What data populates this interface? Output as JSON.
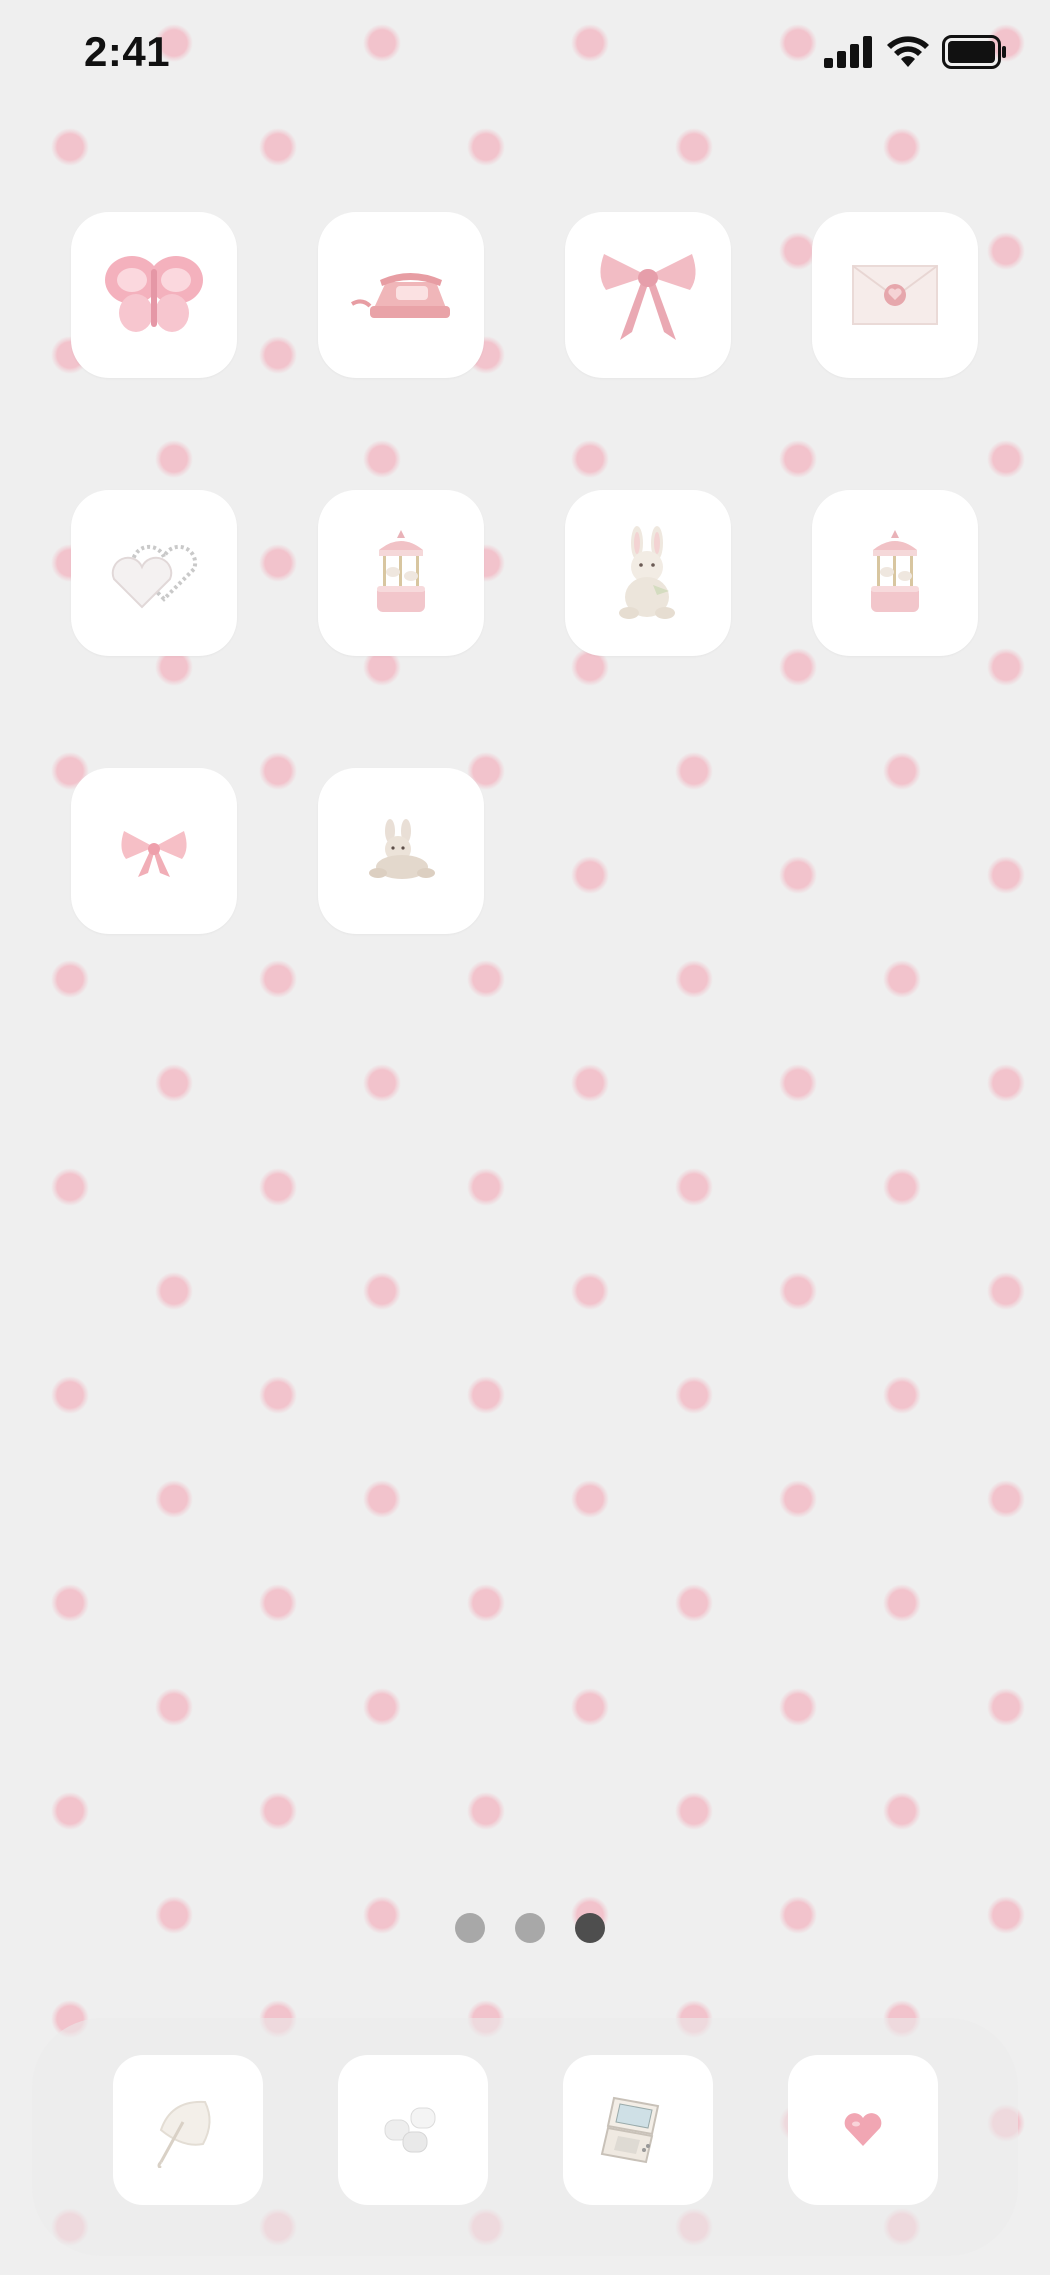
{
  "status_bar": {
    "time": "2:41",
    "icons": [
      "cellular-signal-icon",
      "wifi-icon",
      "battery-icon"
    ]
  },
  "home_grid": {
    "apps": [
      {
        "icon": "pink-butterfly-icon"
      },
      {
        "icon": "pink-telephone-icon"
      },
      {
        "icon": "pink-ribbon-bow-icon"
      },
      {
        "icon": "sealed-envelope-icon"
      },
      {
        "icon": "pearl-hearts-icon"
      },
      {
        "icon": "carousel-music-box-icon"
      },
      {
        "icon": "plush-bunny-icon"
      },
      {
        "icon": "carousel-music-box-icon"
      },
      {
        "icon": "small-pink-bow-icon"
      },
      {
        "icon": "lying-plush-bunny-icon"
      }
    ]
  },
  "page_indicator": {
    "count": 3,
    "active_index": 2
  },
  "dock": {
    "apps": [
      {
        "icon": "lace-parasol-icon"
      },
      {
        "icon": "marshmallows-icon"
      },
      {
        "icon": "handheld-console-icon"
      },
      {
        "icon": "pink-heart-icon"
      }
    ]
  },
  "colors": {
    "wallpaper": "#efefef",
    "polka_dot": "#f2c3cc",
    "icon_tile": "#ffffff",
    "page_dot": "#a8a8a8",
    "page_dot_active": "#4e4e4e"
  }
}
